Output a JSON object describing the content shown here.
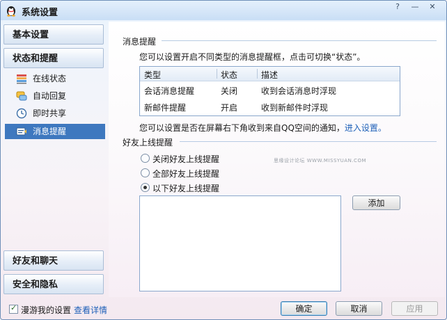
{
  "window": {
    "title": "系统设置",
    "help": "?",
    "minimize": "—",
    "close": "✕"
  },
  "sidebar": {
    "top_headers": [
      "基本设置",
      "状态和提醒"
    ],
    "items": [
      {
        "label": "在线状态",
        "icon": "online-status-icon"
      },
      {
        "label": "自动回复",
        "icon": "auto-reply-icon"
      },
      {
        "label": "即时共享",
        "icon": "instant-share-icon"
      },
      {
        "label": "消息提醒",
        "icon": "message-notice-icon",
        "active": true
      }
    ],
    "bottom_headers": [
      "好友和聊天",
      "安全和隐私"
    ]
  },
  "message_notice": {
    "section_title": "消息提醒",
    "description": "您可以设置开启不同类型的消息提醒框，点击可切换“状态”。",
    "table": {
      "headers": [
        "类型",
        "状态",
        "描述"
      ],
      "rows": [
        [
          "会话消息提醒",
          "关闭",
          "收到会话消息时浮现"
        ],
        [
          "新邮件提醒",
          "开启",
          "收到新邮件时浮现"
        ]
      ]
    },
    "qzone_text": "您可以设置是否在屏幕右下角收到来自QQ空间的通知，",
    "qzone_link": "进入设置。"
  },
  "friend_online": {
    "section_title": "好友上线提醒",
    "options": [
      {
        "label": "关闭好友上线提醒",
        "selected": false
      },
      {
        "label": "全部好友上线提醒",
        "selected": false
      },
      {
        "label": "以下好友上线提醒",
        "selected": true
      }
    ],
    "add_button": "添加"
  },
  "watermark": "思缘设计论坛 WWW.MISSYUAN.COM",
  "footer": {
    "roam_label": "漫游我的设置",
    "roam_checked": true,
    "details_link": "查看详情",
    "ok": "确定",
    "cancel": "取消",
    "apply": "应用"
  },
  "colors": {
    "accent": "#3e78bf",
    "link": "#1e60b8",
    "frame": "#6f8fb8"
  }
}
